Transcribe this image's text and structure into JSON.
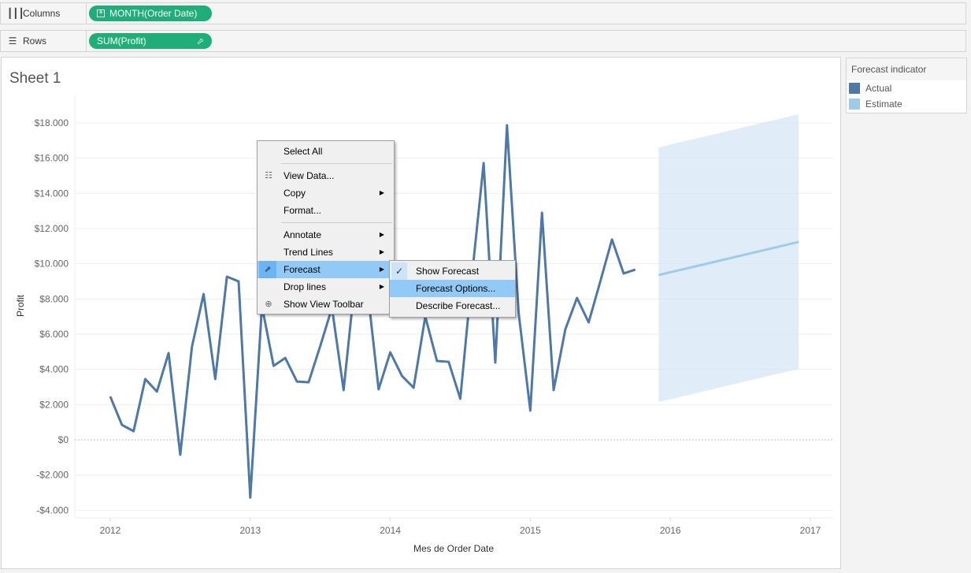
{
  "shelves": {
    "columns": {
      "label": "Columns",
      "icon": "columns-icon",
      "pill": "MONTH(Order Date)"
    },
    "rows": {
      "label": "Rows",
      "icon": "rows-icon",
      "pill": "SUM(Profit)"
    }
  },
  "sheet": {
    "title": "Sheet 1"
  },
  "legend": {
    "title": "Forecast indicator",
    "items": [
      {
        "label": "Actual",
        "color": "#4e79a7"
      },
      {
        "label": "Estimate",
        "color": "#a0cbe8"
      }
    ]
  },
  "context_menu": {
    "items": [
      {
        "label": "Select All"
      },
      {
        "separator": true
      },
      {
        "label": "View Data...",
        "icon": "table-icon"
      },
      {
        "label": "Copy",
        "submenu": true
      },
      {
        "label": "Format..."
      },
      {
        "separator": true
      },
      {
        "label": "Annotate",
        "submenu": true
      },
      {
        "label": "Trend Lines",
        "submenu": true
      },
      {
        "label": "Forecast",
        "submenu": true,
        "highlighted": true,
        "icon": "forecast-arrow-icon"
      },
      {
        "label": "Drop lines",
        "submenu": true
      },
      {
        "label": "Show View Toolbar",
        "icon": "zoom-in-icon"
      }
    ],
    "forecast_submenu": [
      {
        "label": "Show Forecast",
        "checked": true
      },
      {
        "label": "Forecast Options...",
        "highlighted": true
      },
      {
        "label": "Describe Forecast..."
      }
    ]
  },
  "chart_data": {
    "type": "line",
    "title": "",
    "xlabel": "Mes de Order Date",
    "ylabel": "Profit",
    "ylim": [
      -4000,
      18000
    ],
    "y_ticks": [
      -4000,
      -2000,
      0,
      2000,
      4000,
      6000,
      8000,
      10000,
      12000,
      14000,
      16000,
      18000
    ],
    "y_tick_labels": [
      "-$4.000",
      "-$2.000",
      "$0",
      "$2.000",
      "$4.000",
      "$6.000",
      "$8.000",
      "$10.000",
      "$12.000",
      "$14.000",
      "$16.000",
      "$18.000"
    ],
    "x_tick_labels": [
      "2012",
      "2013",
      "2014",
      "2015",
      "2016",
      "2017"
    ],
    "xlim_months": [
      0,
      60
    ],
    "grid": true,
    "legend_position": "right",
    "series": [
      {
        "name": "Actual",
        "color": "#4e79a7",
        "x_month_index": [
          0,
          1,
          2,
          3,
          4,
          5,
          6,
          7,
          8,
          9,
          10,
          11,
          12,
          13,
          14,
          15,
          16,
          17,
          18,
          19,
          20,
          21,
          22,
          23,
          24,
          25,
          26,
          27,
          28,
          29,
          30,
          31,
          32,
          33,
          34,
          35,
          36,
          37,
          38,
          39,
          40,
          41,
          42,
          43,
          44,
          45,
          46
        ],
        "values": [
          2460,
          850,
          490,
          3450,
          2740,
          4930,
          -850,
          5280,
          8280,
          3450,
          9270,
          9000,
          -3280,
          7600,
          4200,
          4650,
          3310,
          3270,
          5330,
          7500,
          2820,
          9200,
          8800,
          2870,
          4970,
          3630,
          2960,
          7000,
          4480,
          4430,
          2330,
          9300,
          15720,
          4390,
          17870,
          7210,
          1660,
          12900,
          2820,
          6270,
          8060,
          6670,
          9000,
          11380,
          9450,
          9670,
          9360
        ]
      },
      {
        "name": "Estimate",
        "color": "#a0cbe8",
        "x_month_index": [
          47,
          59
        ],
        "values": [
          9360,
          11240
        ],
        "band_upper": [
          16610,
          18490
        ],
        "band_lower": [
          2150,
          4030
        ]
      }
    ]
  }
}
